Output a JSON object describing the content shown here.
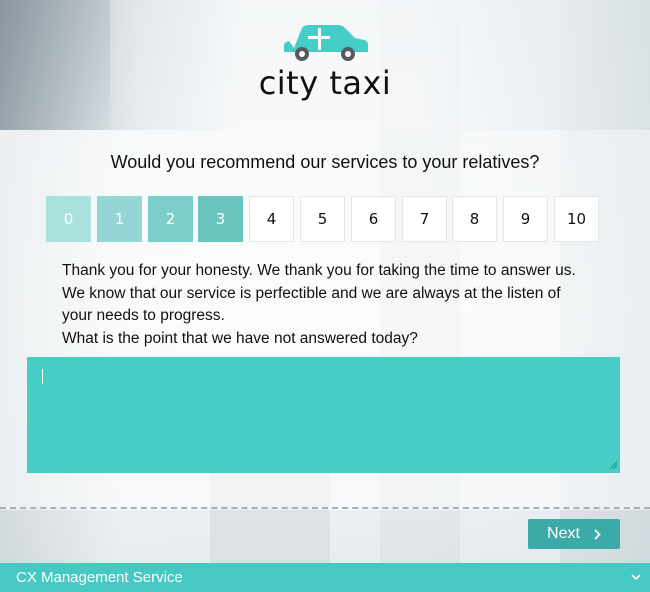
{
  "brand": {
    "name": "city taxi",
    "logo_icon": "taxi-car-icon",
    "accent_color": "#46cdc8"
  },
  "survey": {
    "question": "Would you recommend our services to your relatives?",
    "scale": {
      "options": [
        "0",
        "1",
        "2",
        "3",
        "4",
        "5",
        "6",
        "7",
        "8",
        "9",
        "10"
      ],
      "selected": "3",
      "selected_colors": [
        "#a9e1df",
        "#94d6d4",
        "#7dcdca",
        "#6cc4c1"
      ]
    },
    "followup": {
      "lines": [
        "Thank you for your honesty. We thank you for taking the time to answer us.",
        "We know that our service is perfectible and we are always at the listen of",
        "your needs to progress.",
        "What is the point that we have not answered today?"
      ]
    },
    "answer": {
      "value": "",
      "color": "#46cdc8"
    }
  },
  "navigation": {
    "next_label": "Next",
    "next_icon": "chevron-right-icon"
  },
  "footer": {
    "label": "CX Management Service",
    "toggle_icon": "chevron-down-icon",
    "color": "#46c8c3"
  }
}
